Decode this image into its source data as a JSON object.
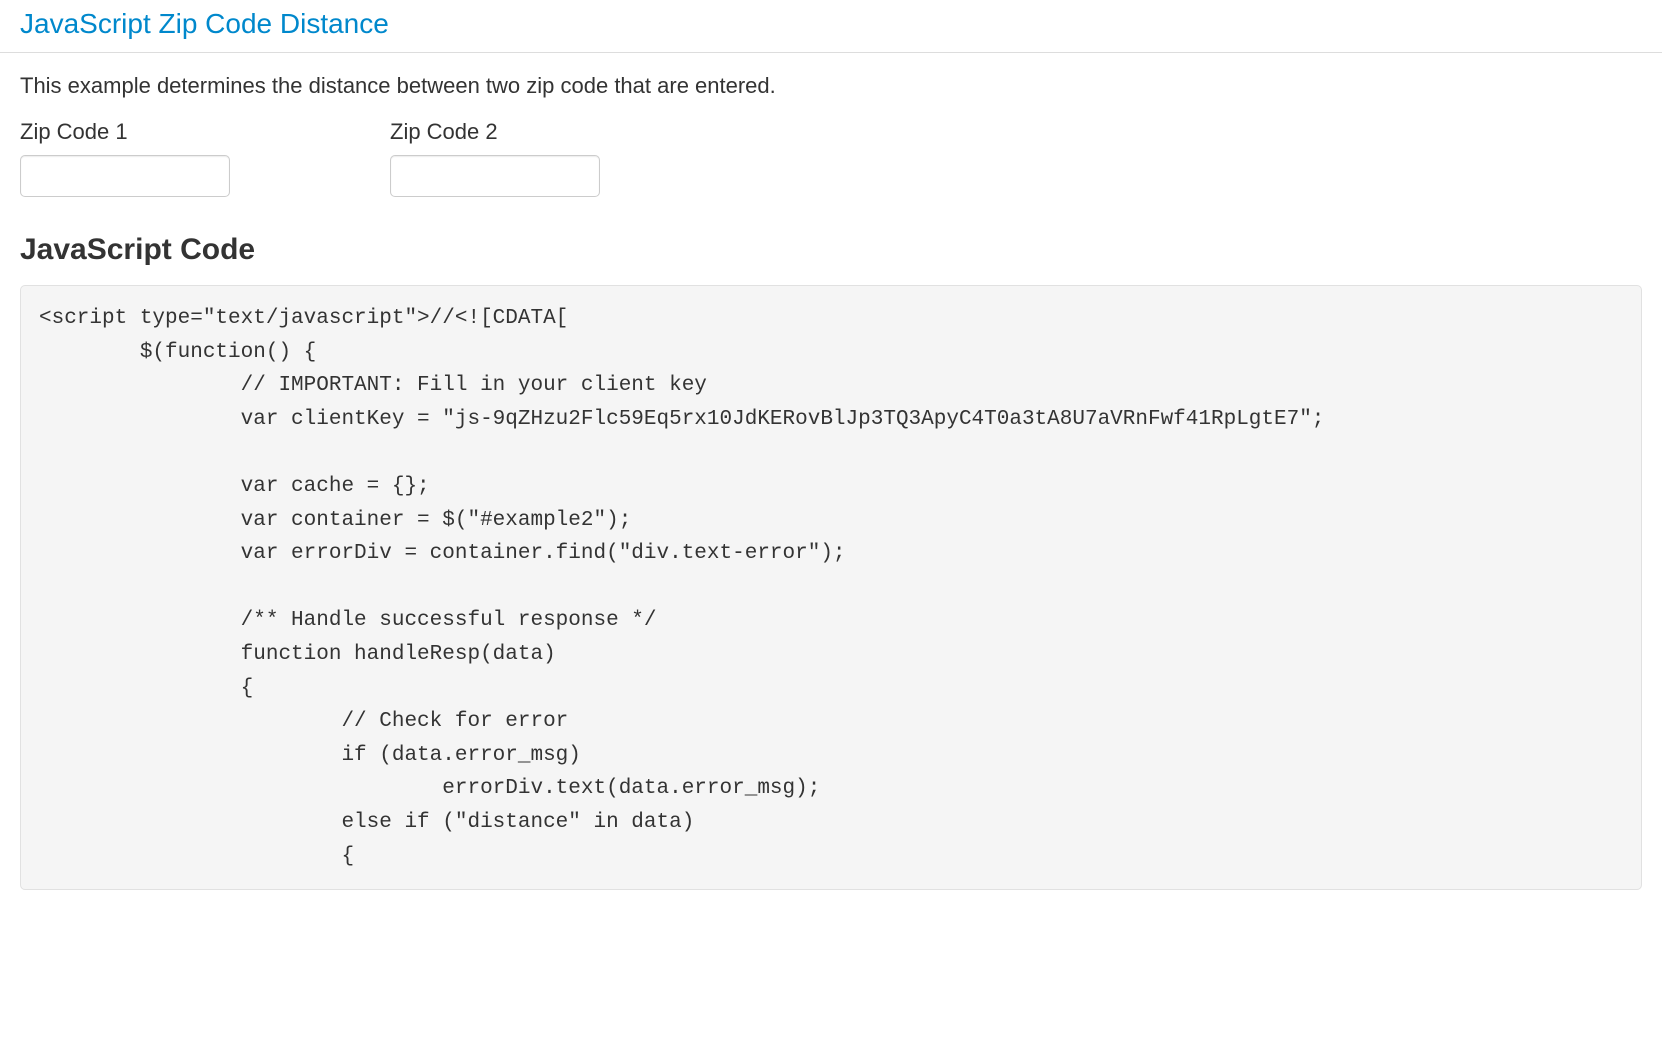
{
  "header": {
    "title_link": "JavaScript Zip Code Distance"
  },
  "main": {
    "description": "This example determines the distance between two zip code that are entered.",
    "form": {
      "zip1_label": "Zip Code 1",
      "zip2_label": "Zip Code 2"
    },
    "code_section": {
      "heading": "JavaScript Code",
      "code": "<script type=\"text/javascript\">//<![CDATA[\n        $(function() {\n                // IMPORTANT: Fill in your client key\n                var clientKey = \"js-9qZHzu2Flc59Eq5rx10JdKERovBlJp3TQ3ApyC4T0a3tA8U7aVRnFwf41RpLgtE7\";\n\n                var cache = {};\n                var container = $(\"#example2\");\n                var errorDiv = container.find(\"div.text-error\");\n\n                /** Handle successful response */\n                function handleResp(data)\n                {\n                        // Check for error\n                        if (data.error_msg)\n                                errorDiv.text(data.error_msg);\n                        else if (\"distance\" in data)\n                        {"
    }
  }
}
